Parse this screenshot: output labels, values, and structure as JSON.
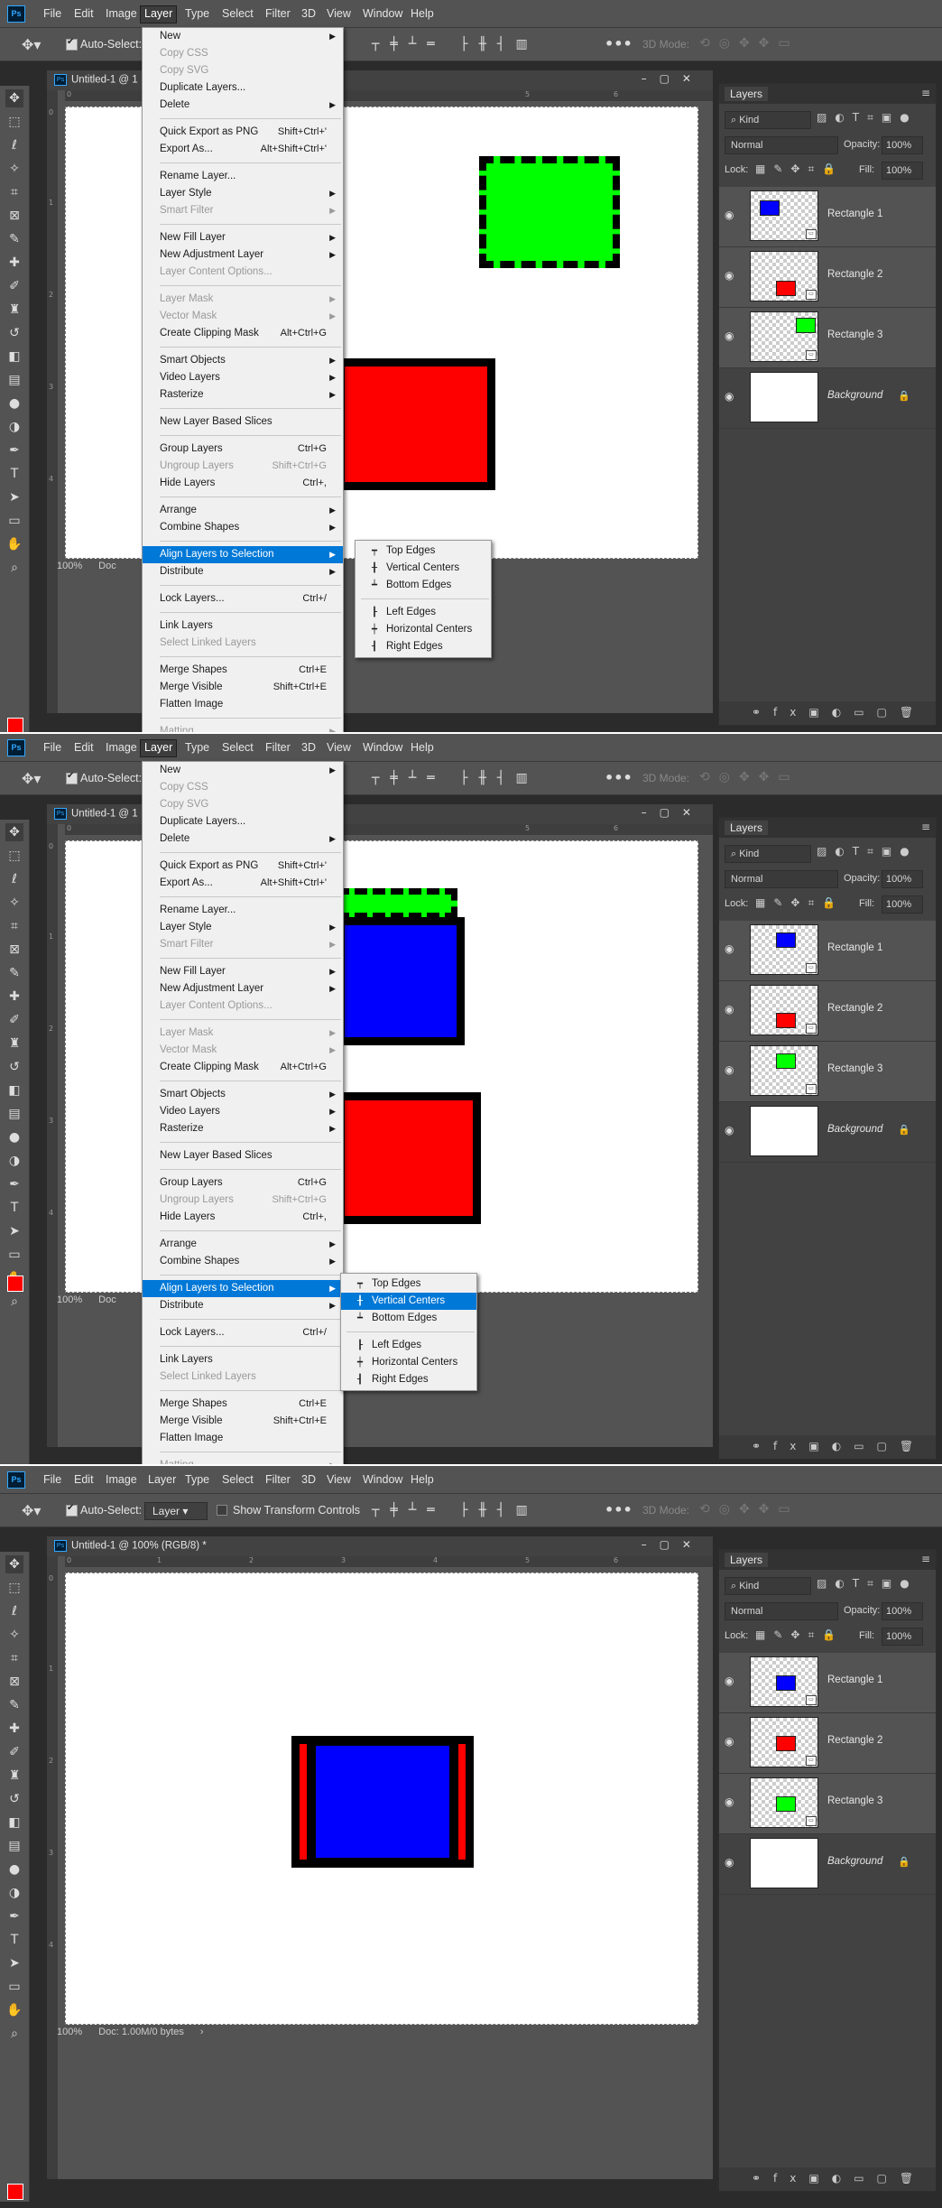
{
  "app": {
    "menubar": [
      "File",
      "Edit",
      "Image",
      "Layer",
      "Type",
      "Select",
      "Filter",
      "3D",
      "View",
      "Window",
      "Help"
    ],
    "active_menu": "Layer",
    "options": {
      "auto_select_label": "Auto-Select:",
      "layer_select_value": "Layer",
      "show_transform_label": "Show Transform Controls",
      "mode_3d_label": "3D Mode:"
    },
    "doc_title": "Untitled-1 @ 100% (RGB/8) *",
    "doc_title_short": "Untitled-1 @ 1",
    "zoom": "100%",
    "doc_size": "Doc: 1.00M/0 bytes",
    "doc_size_short": "Doc",
    "ruler_h": [
      "0",
      "1",
      "2",
      "3",
      "4",
      "5",
      "6"
    ],
    "ruler_v": [
      "0",
      "1",
      "2",
      "3",
      "4"
    ]
  },
  "layers_panel": {
    "tab": "Layers",
    "kind": "Kind",
    "blend_mode": "Normal",
    "opacity_label": "Opacity:",
    "opacity": "100%",
    "lock_label": "Lock:",
    "fill_label": "Fill:",
    "fill": "100%",
    "layers": [
      {
        "name": "Rectangle 1",
        "swatch": "#0000ff",
        "icon": "eye-icon"
      },
      {
        "name": "Rectangle 2",
        "swatch": "#ff0000",
        "icon": "eye-icon"
      },
      {
        "name": "Rectangle 3",
        "swatch": "#00ff00",
        "icon": "eye-icon"
      },
      {
        "name": "Background",
        "swatch": "#ffffff",
        "icon": "eye-icon",
        "locked": true
      }
    ]
  },
  "layer_menu": {
    "items": [
      {
        "label": "New",
        "arrow": true
      },
      {
        "label": "Copy CSS",
        "disabled": true
      },
      {
        "label": "Copy SVG",
        "disabled": true
      },
      {
        "label": "Duplicate Layers..."
      },
      {
        "label": "Delete",
        "arrow": true
      },
      {
        "sep": true
      },
      {
        "label": "Quick Export as PNG",
        "shortcut": "Shift+Ctrl+'"
      },
      {
        "label": "Export As...",
        "shortcut": "Alt+Shift+Ctrl+'"
      },
      {
        "sep": true
      },
      {
        "label": "Rename Layer..."
      },
      {
        "label": "Layer Style",
        "arrow": true
      },
      {
        "label": "Smart Filter",
        "disabled": true,
        "arrow": true
      },
      {
        "sep": true
      },
      {
        "label": "New Fill Layer",
        "arrow": true
      },
      {
        "label": "New Adjustment Layer",
        "arrow": true
      },
      {
        "label": "Layer Content Options...",
        "disabled": true
      },
      {
        "sep": true
      },
      {
        "label": "Layer Mask",
        "disabled": true,
        "arrow": true
      },
      {
        "label": "Vector Mask",
        "disabled": true,
        "arrow": true
      },
      {
        "label": "Create Clipping Mask",
        "shortcut": "Alt+Ctrl+G"
      },
      {
        "sep": true
      },
      {
        "label": "Smart Objects",
        "arrow": true
      },
      {
        "label": "Video Layers",
        "arrow": true
      },
      {
        "label": "Rasterize",
        "arrow": true
      },
      {
        "sep": true
      },
      {
        "label": "New Layer Based Slices"
      },
      {
        "sep": true
      },
      {
        "label": "Group Layers",
        "shortcut": "Ctrl+G"
      },
      {
        "label": "Ungroup Layers",
        "shortcut": "Shift+Ctrl+G",
        "disabled": true
      },
      {
        "label": "Hide Layers",
        "shortcut": "Ctrl+,"
      },
      {
        "sep": true
      },
      {
        "label": "Arrange",
        "arrow": true
      },
      {
        "label": "Combine Shapes",
        "arrow": true
      },
      {
        "sep": true
      },
      {
        "label": "Align Layers to Selection",
        "arrow": true,
        "highlight": true
      },
      {
        "label": "Distribute",
        "arrow": true
      },
      {
        "sep": true
      },
      {
        "label": "Lock Layers...",
        "shortcut": "Ctrl+/"
      },
      {
        "sep": true
      },
      {
        "label": "Link Layers"
      },
      {
        "label": "Select Linked Layers",
        "disabled": true
      },
      {
        "sep": true
      },
      {
        "label": "Merge Shapes",
        "shortcut": "Ctrl+E"
      },
      {
        "label": "Merge Visible",
        "shortcut": "Shift+Ctrl+E"
      },
      {
        "label": "Flatten Image"
      },
      {
        "sep": true
      },
      {
        "label": "Matting",
        "arrow": true,
        "disabled": true
      }
    ]
  },
  "align_submenu": {
    "items": [
      {
        "label": "Top Edges",
        "icon": "align-top-icon"
      },
      {
        "label": "Vertical Centers",
        "icon": "align-vcenter-icon"
      },
      {
        "label": "Bottom Edges",
        "icon": "align-bottom-icon"
      },
      {
        "sep": true
      },
      {
        "label": "Left Edges",
        "icon": "align-left-icon"
      },
      {
        "label": "Horizontal Centers",
        "icon": "align-hcenter-icon"
      },
      {
        "label": "Right Edges",
        "icon": "align-right-icon"
      }
    ],
    "highlighted_in_step2": "Vertical Centers"
  },
  "colors": {
    "green": "#00ff00",
    "red": "#ff0000",
    "blue": "#0000ff",
    "menu_highlight": "#0078d7",
    "ui_dark": "#535353"
  }
}
